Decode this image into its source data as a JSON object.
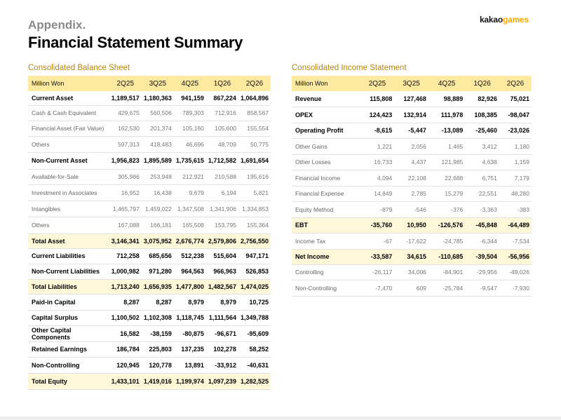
{
  "header": {
    "pretitle": "Appendix.",
    "title": "Financial Statement Summary",
    "logo_main": "kakao",
    "logo_accent": "games",
    "accent_color": "#f5a800"
  },
  "balance_sheet": {
    "title": "Consolidated Balance Sheet",
    "columns": [
      "Million Won",
      "2Q25",
      "3Q25",
      "4Q25",
      "1Q26",
      "2Q26"
    ],
    "rows": [
      {
        "label": "Current Asset",
        "values": [
          "1,189,517",
          "1,180,363",
          "941,159",
          "867,224",
          "1,064,896"
        ],
        "style": "bold",
        "h": 20
      },
      {
        "label": "Cash & Cash Equivalent",
        "values": [
          "429,675",
          "560,506",
          "789,303",
          "712,916",
          "858,567"
        ],
        "style": "sub",
        "h": 22
      },
      {
        "label": "Financial Asset (Fair Value)",
        "values": [
          "162,530",
          "201,374",
          "105,160",
          "105,600",
          "155,554"
        ],
        "style": "sub",
        "h": 22
      },
      {
        "label": "Others",
        "values": [
          "597,313",
          "418,483",
          "46,696",
          "48,709",
          "50,775"
        ],
        "style": "sub",
        "h": 23
      },
      {
        "label": "Non-Current Asset",
        "values": [
          "1,956,823",
          "1,895,589",
          "1,735,615",
          "1,712,582",
          "1,691,654"
        ],
        "style": "bold",
        "h": 24
      },
      {
        "label": "Available-for-Sale",
        "values": [
          "305,986",
          "253,948",
          "212,921",
          "210,588",
          "195,616"
        ],
        "style": "sub",
        "h": 22
      },
      {
        "label": "Investment in Associates",
        "values": [
          "16,952",
          "16,438",
          "9,679",
          "6,194",
          "5,821"
        ],
        "style": "sub",
        "h": 23
      },
      {
        "label": "Intangibles",
        "values": [
          "1,465,797",
          "1,459,022",
          "1,347,508",
          "1,341,906",
          "1,334,853"
        ],
        "style": "sub",
        "h": 23
      },
      {
        "label": "Others",
        "values": [
          "167,088",
          "166,181",
          "165,508",
          "153,795",
          "155,364"
        ],
        "style": "sub",
        "h": 24
      },
      {
        "label": "Total Asset",
        "values": [
          "3,146,341",
          "3,075,952",
          "2,676,774",
          "2,579,806",
          "2,756,550"
        ],
        "style": "total",
        "h": 21
      },
      {
        "label": "Current Liabilities",
        "values": [
          "712,258",
          "685,656",
          "512,238",
          "515,604",
          "947,171"
        ],
        "style": "bold",
        "h": 22
      },
      {
        "label": "Non-Current Liabilities",
        "values": [
          "1,000,982",
          "971,280",
          "964,563",
          "966,963",
          "526,853"
        ],
        "style": "bold",
        "h": 22
      },
      {
        "label": "Total Liabilities",
        "values": [
          "1,713,240",
          "1,656,935",
          "1,477,800",
          "1,482,567",
          "1,474,025"
        ],
        "style": "total",
        "h": 21
      },
      {
        "label": "Paid-in Capital",
        "values": [
          "8,287",
          "8,287",
          "8,979",
          "8,979",
          "10,725"
        ],
        "style": "bold",
        "h": 23
      },
      {
        "label": "Capital Surplus",
        "values": [
          "1,100,502",
          "1,102,308",
          "1,118,745",
          "1,111,564",
          "1,349,788"
        ],
        "style": "bold",
        "h": 22
      },
      {
        "label": "Other Capital Components",
        "values": [
          "16,582",
          "-38,159",
          "-80,875",
          "-96,671",
          "-95,609"
        ],
        "style": "bold",
        "h": 23
      },
      {
        "label": "Retained Earnings",
        "values": [
          "186,784",
          "225,803",
          "137,235",
          "102,278",
          "58,252"
        ],
        "style": "bold",
        "h": 22
      },
      {
        "label": "Non-Controlling",
        "values": [
          "120,945",
          "120,778",
          "13,891",
          "-33,912",
          "-40,631"
        ],
        "style": "bold",
        "h": 23
      },
      {
        "label": "Total Equity",
        "values": [
          "1,433,101",
          "1,419,016",
          "1,199,974",
          "1,097,239",
          "1,282,525"
        ],
        "style": "total",
        "h": 23
      }
    ]
  },
  "income_statement": {
    "title": "Consolidated Income Statement",
    "columns": [
      "Million Won",
      "2Q25",
      "3Q25",
      "4Q25",
      "1Q26",
      "2Q26"
    ],
    "rows": [
      {
        "label": "Revenue",
        "values": [
          "115,808",
          "127,468",
          "98,889",
          "82,926",
          "75,021"
        ],
        "style": "bold",
        "h": 22
      },
      {
        "label": "OPEX",
        "values": [
          "124,423",
          "132,914",
          "111,978",
          "108,385",
          "-98,047"
        ],
        "style": "bold",
        "h": 23
      },
      {
        "label": "Operating Profit",
        "values": [
          "-8,615",
          "-5,447",
          "-13,089",
          "-25,460",
          "-23,026"
        ],
        "style": "bold",
        "h": 22
      },
      {
        "label": "Other Gains",
        "values": [
          "1,221",
          "2,056",
          "1,465",
          "3,412",
          "1,180"
        ],
        "style": "sub",
        "h": 23
      },
      {
        "label": "Other Losses",
        "values": [
          "16,733",
          "4,437",
          "121,985",
          "4,638",
          "1,159"
        ],
        "style": "sub",
        "h": 22
      },
      {
        "label": "Financial Income",
        "values": [
          "4,094",
          "22,108",
          "22,688",
          "6,751",
          "7,179"
        ],
        "style": "sub",
        "h": 23
      },
      {
        "label": "Financial Expense",
        "values": [
          "14,849",
          "2,785",
          "15,279",
          "22,551",
          "48,280"
        ],
        "style": "sub",
        "h": 22
      },
      {
        "label": "Equity Method",
        "values": [
          "-879",
          "-546",
          "-376",
          "-3,363",
          "-383"
        ],
        "style": "sub",
        "h": 23
      },
      {
        "label": "EBT",
        "values": [
          "-35,760",
          "10,950",
          "-126,576",
          "-45,848",
          "-64,489"
        ],
        "style": "total",
        "h": 22
      },
      {
        "label": "Income Tax",
        "values": [
          "-67",
          "-17,622",
          "-24,785",
          "-6,344",
          "-7,534"
        ],
        "style": "sub",
        "h": 23
      },
      {
        "label": "Net Income",
        "values": [
          "-33,587",
          "34,615",
          "-110,685",
          "-39,504",
          "-56,956"
        ],
        "style": "total",
        "h": 22
      },
      {
        "label": "Controlling",
        "values": [
          "-26,117",
          "34,006",
          "-84,901",
          "-29,956",
          "-49,026"
        ],
        "style": "sub",
        "h": 22
      },
      {
        "label": "Non-Controlling",
        "values": [
          "-7,470",
          "609",
          "-25,784",
          "-9,547",
          "-7,930"
        ],
        "style": "sub",
        "h": 23
      }
    ]
  }
}
